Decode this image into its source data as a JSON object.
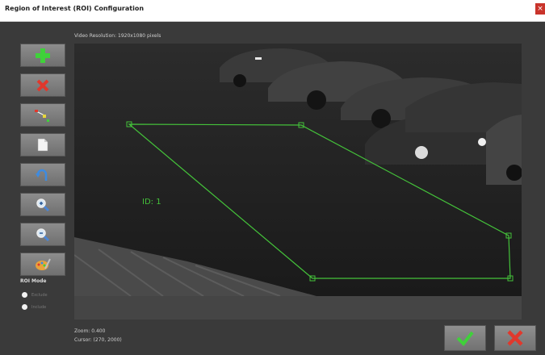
{
  "window": {
    "title": "Region of Interest (ROI) Configuration",
    "close_glyph": "×"
  },
  "toolbar": {
    "tools": [
      {
        "icon": "add-icon"
      },
      {
        "icon": "delete-icon"
      },
      {
        "icon": "polygon-points-icon"
      },
      {
        "icon": "document-icon"
      },
      {
        "icon": "undo-icon"
      },
      {
        "icon": "zoom-in-icon"
      },
      {
        "icon": "zoom-out-icon"
      },
      {
        "icon": "palette-icon"
      }
    ]
  },
  "roi_mode": {
    "label": "ROI Mode",
    "options": [
      "Exclude",
      "Include"
    ],
    "selected": "Exclude"
  },
  "video": {
    "resolution_text": "Video Resolution: 1920x1080 pixels",
    "roi_label": "ID: 1",
    "roi_color": "#44c23a"
  },
  "status": {
    "zoom": "Zoom: 0.400",
    "cursor": "Cursor: (270, 2000)"
  },
  "actions": {
    "ok_icon": "checkmark-icon",
    "cancel_icon": "cancel-icon"
  }
}
